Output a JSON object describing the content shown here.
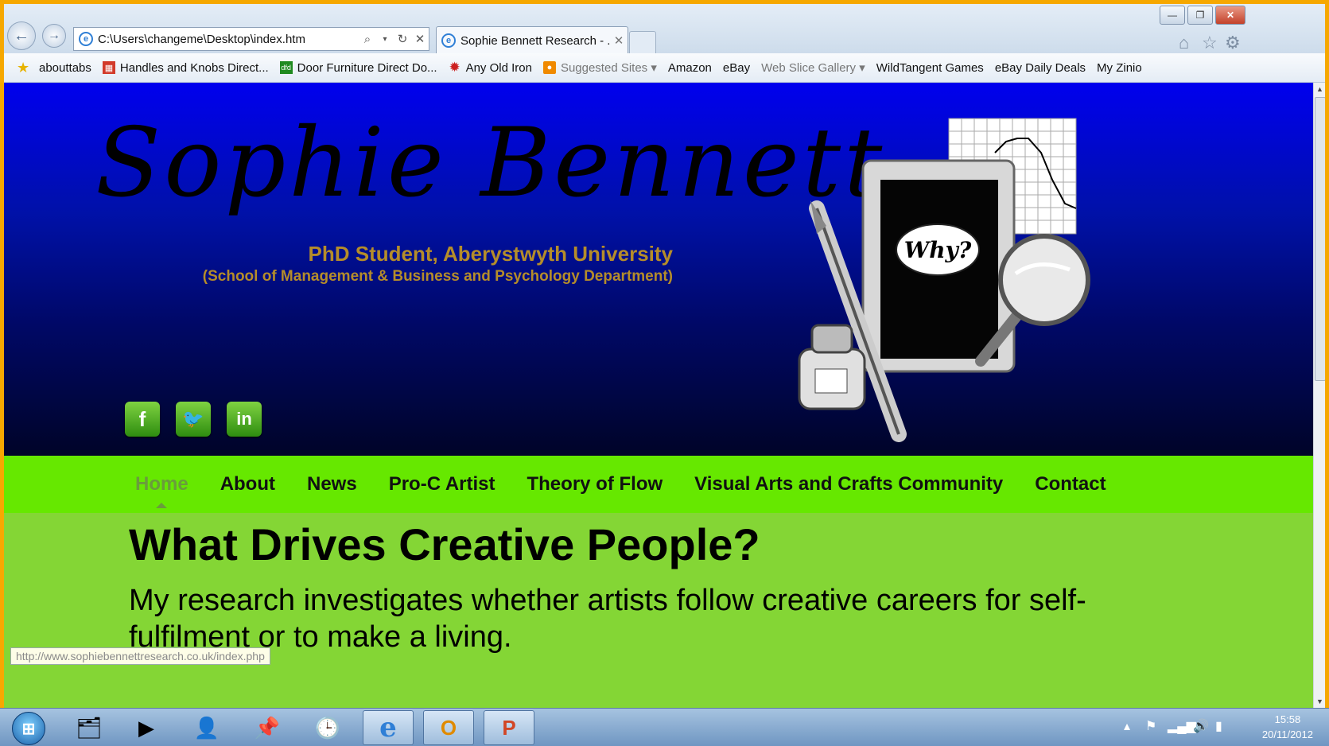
{
  "window": {
    "controls": {
      "minimize": "—",
      "restore": "❐",
      "close": "✕"
    }
  },
  "browser": {
    "address_url": "C:\\Users\\changeme\\Desktop\\index.htm",
    "tab_title": "Sophie Bennett Research - ...",
    "favorites": [
      {
        "label": "abouttabs",
        "icon": "page-icon"
      },
      {
        "label": "Handles and Knobs Direct...",
        "icon": "page-icon"
      },
      {
        "label": "Door Furniture Direct  Do...",
        "icon": "dfd-icon"
      },
      {
        "label": "Any Old Iron",
        "icon": "gear-icon"
      },
      {
        "label": "Suggested Sites ▾",
        "icon": "suggested-icon"
      },
      {
        "label": "Amazon",
        "icon": "page-icon"
      },
      {
        "label": "eBay",
        "icon": "page-icon"
      },
      {
        "label": "Web Slice Gallery ▾",
        "icon": "page-icon"
      },
      {
        "label": "WildTangent Games",
        "icon": "page-icon"
      },
      {
        "label": "eBay Daily Deals",
        "icon": "page-icon"
      },
      {
        "label": "My Zinio",
        "icon": "page-icon"
      }
    ],
    "status_url": "http://www.sophiebennettresearch.co.uk/index.php"
  },
  "site": {
    "name": "Sophie Bennett",
    "subtitle": "PhD Student, Aberystwyth University",
    "department": "(School of Management & Business and Psychology Department)",
    "art_label": "Why?",
    "social": [
      {
        "name": "facebook",
        "glyph": "f"
      },
      {
        "name": "twitter",
        "glyph": "🐦"
      },
      {
        "name": "linkedin",
        "glyph": "in"
      }
    ],
    "menu": [
      "Home",
      "About",
      "News",
      "Pro-C Artist",
      "Theory of Flow",
      "Visual Arts and Crafts Community",
      "Contact"
    ],
    "active_menu": "Home",
    "heading": "What Drives Creative People?",
    "intro": "My research investigates whether artists follow creative careers for self-fulfilment or to make a living."
  },
  "taskbar": {
    "apps": [
      "start-button",
      "explorer-icon",
      "media-player-icon",
      "user-icon",
      "pin-icon",
      "clock-app-icon",
      "internet-explorer-icon",
      "outlook-icon",
      "powerpoint-icon"
    ],
    "time": "15:58",
    "date": "20/11/2012"
  },
  "colors": {
    "header_top": "#0000ee",
    "menu_bg": "#66e800",
    "content_bg": "#84d635",
    "subtitle": "#b58d2a"
  }
}
